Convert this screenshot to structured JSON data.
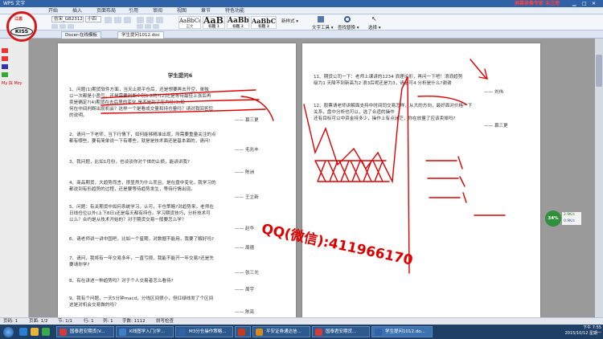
{
  "window": {
    "app_title": "WPS 文字",
    "right_note": "屏幕录像专家 未注册"
  },
  "menu": {
    "items": [
      "开始",
      "插入",
      "页面布局",
      "引用",
      "审阅",
      "视图",
      "章节",
      "特色功能"
    ]
  },
  "ribbon": {
    "font_name": "仿宋_GB2312",
    "font_size": "小四",
    "styles": [
      {
        "preview": "AaBbCcDd",
        "label": "正文"
      },
      {
        "preview": "AaBl",
        "label": "标题 1"
      },
      {
        "preview": "AaBb(",
        "label": "标题 2"
      },
      {
        "preview": "AaBbC(",
        "label": "标题 3"
      }
    ],
    "new_style": "新样式 ▾",
    "text_tools": "文字工具 ▾",
    "find_replace": "查找替换 ▾",
    "select": "选择 ▾"
  },
  "tabs": [
    "Docer-在线模板",
    "学生提问1012.doc"
  ],
  "left_panel": {
    "label": "My 拟 Mzy"
  },
  "logo": {
    "text": "KISS",
    "top": "江恩"
  },
  "document": {
    "title": "学生提问6",
    "left_paragraphs": [
      "1、问题(1)期货软件方面，当天止损平仓后，还是想要再去开空，单独\n以一次都是小盈亏。还是需要判断个别1.2的?(2)还是等待最佳上涨后再\n卖是确定?(4)期货在去后里的变化,是不是到了压力位(3)如\n何在中间判断出现机会？这样一个是看成交量和持仓量吗？请对我回答您\n的说明。",
      "2、请问一下老师，当下行情下，如何能够精准出现，所需要重量关注的点\n都有哪些，要有简单说一下有哪些，就是是技术面还是基本面的，请问!",
      "3、我问题，比如1月份，也谈谈你对个体的止损，能讲讲我?",
      "4、商品期货，大趋势而言，很显然为什么而且，是在盘中变化，我学习的\n都说到有形趋势的过程，还是要等待趋势发生，等待行情出现。",
      "5、问题：有关期货中如何系统学习，认可，平仓策略?对趋势来，老师在\n日线仓位以外(上下8日)还是每天都有持仓。学习期货技巧，分析技术可\n以么？合约是从技术开始的？对于期货交易一般要怎么学？",
      "6、请老师讲一讲中国吧，比如一个星期，对数据不能用，我要了解好吗?",
      "7、请问，我将有一年交易多年，一直亏损，我能不能开一年交易?还是先\n要请你学?",
      "8、有在讲述一种趋势吗？对于个人交易者怎么看待?",
      "9、我有个问题，一天5分钟macd，分线区间很小，但红绿线发了个区间\n这是对机会交易做的吗？"
    ],
    "left_signatures": [
      "—— 慕三更",
      "—— 毛兆丰",
      "—— 陈洲",
      "—— 王立新",
      "—— 赵华",
      "—— 周德",
      "—— 张三光",
      "—— 周宇",
      "—— 陈亮"
    ],
    "right_paragraphs": [
      "11、期货公司一下：老师上课讲的1234 浪理论形，再问一下吧！浪浪趋势\n级为1 天降不到新高为2 浪3后呢还是为3，请是可4 分析是什么?谢谢",
      "12、股票请老师讲解面支持中时间同交易怎样，从大的方向，最好面对价格一下\n关系，盘中分析也可以，选了合适的操作\n还有目标可以中资金持多少，操作上有点迷茫，你在放量了应该卖掉吗?"
    ],
    "right_signatures": [
      "—— 刘伟",
      "—— 慕三更"
    ]
  },
  "overlay": {
    "watermark": "QQ(微信):411966170",
    "percent": "34%",
    "speed_up": "2.9K/s",
    "speed_down": "0.9K/s"
  },
  "statusbar": {
    "page": "页码: 1",
    "pages": "页面: 1/2",
    "section": "节: 1/1",
    "row": "行: 1",
    "col": "列: 1",
    "words": "字数: 1112",
    "spell": "拼写检查"
  },
  "taskbar": {
    "items": [
      "国泰君安期货(V...",
      "K线图学入门(学...",
      "M3分仓操作策略...",
      "",
      "平安证券通达信...",
      "国泰君安期货...",
      "学生提问1012.do..."
    ],
    "time": "下午 7:55",
    "date": "2015/10/12 星期一"
  },
  "colors": {
    "accent": "#2f62a6",
    "annotation": "#e00000",
    "watermark": "#e00000"
  }
}
